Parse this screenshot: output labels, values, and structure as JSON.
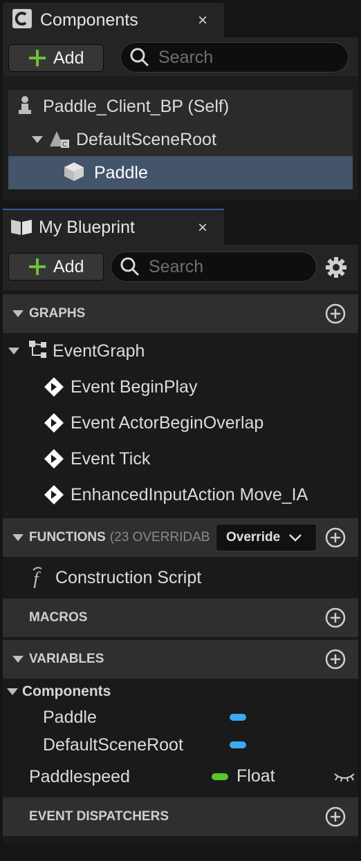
{
  "components_panel": {
    "tab_title": "Components",
    "close": "×",
    "add_label": "Add",
    "search_placeholder": "Search",
    "tree": [
      {
        "label": "Paddle_Client_BP (Self)"
      },
      {
        "label": "DefaultSceneRoot"
      },
      {
        "label": "Paddle"
      }
    ]
  },
  "blueprint_panel": {
    "tab_title": "My Blueprint",
    "close": "×",
    "add_label": "Add",
    "search_placeholder": "Search",
    "graphs": {
      "title": "GRAPHS",
      "event_graph": "EventGraph",
      "events": [
        "Event BeginPlay",
        "Event ActorBeginOverlap",
        "Event Tick",
        "EnhancedInputAction Move_IA"
      ]
    },
    "functions": {
      "title": "FUNCTIONS",
      "count_text": "(23 OVERRIDAB",
      "override_label": "Override",
      "items": [
        "Construction Script"
      ]
    },
    "macros": {
      "title": "MACROS"
    },
    "variables": {
      "title": "VARIABLES",
      "category": "Components",
      "items": [
        {
          "name": "Paddle",
          "color": "#3ea8f2"
        },
        {
          "name": "DefaultSceneRoot",
          "color": "#3ea8f2"
        }
      ],
      "paddlespeed": {
        "name": "Paddlespeed",
        "type": "Float",
        "color": "#5ac42e"
      }
    },
    "event_dispatchers": {
      "title": "EVENT DISPATCHERS"
    }
  },
  "colors": {
    "selection": "#44546a",
    "add_icon": "#6fc13a",
    "panel": "#242424",
    "section": "#2f2f2f"
  }
}
